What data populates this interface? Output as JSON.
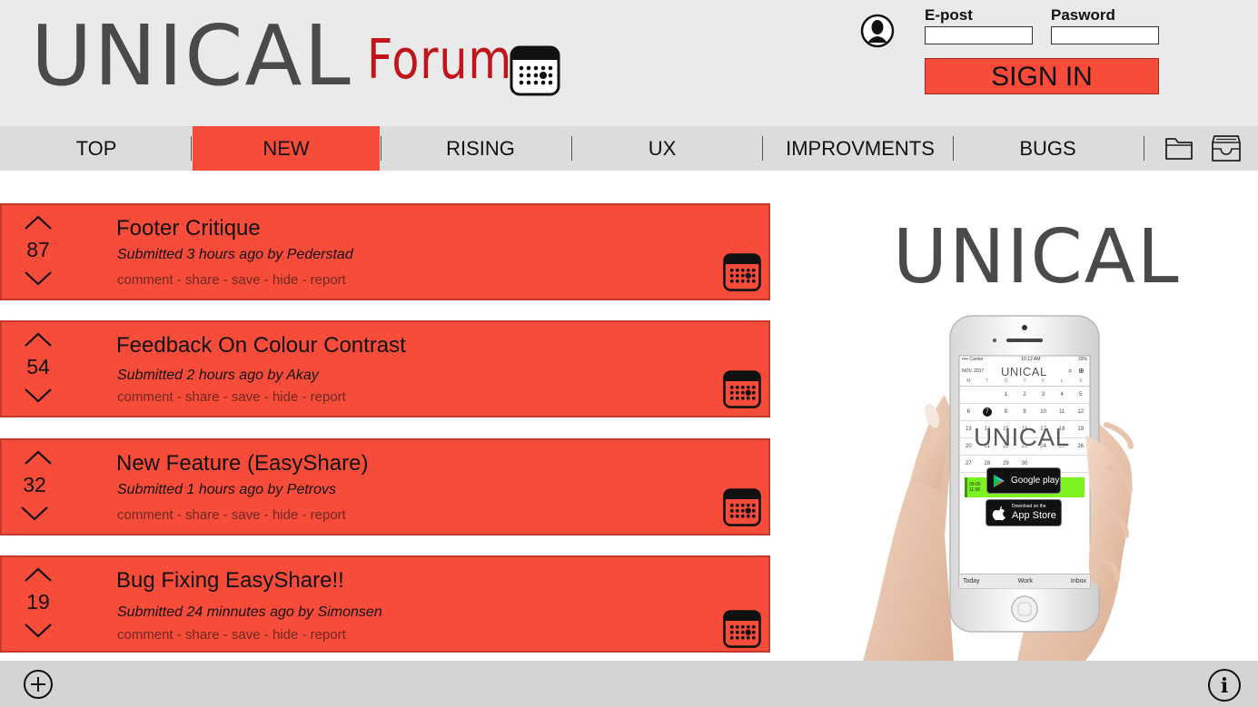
{
  "header": {
    "logo_text": "UNICAL",
    "forum_text": "Forum",
    "email_label": "E-post",
    "password_label": "Pasword",
    "email_value": "",
    "password_value": "",
    "signin_label": "SIGN IN"
  },
  "nav": {
    "tabs": [
      {
        "label": "TOP",
        "active": false
      },
      {
        "label": "NEW",
        "active": true
      },
      {
        "label": "RISING",
        "active": false
      },
      {
        "label": "UX",
        "active": false
      },
      {
        "label": "IMPROVMENTS",
        "active": false
      },
      {
        "label": "BUGS",
        "active": false
      }
    ],
    "icons": [
      "folder-icon",
      "inbox-icon"
    ]
  },
  "posts": [
    {
      "votes": "87",
      "title": "Footer Critique",
      "meta": "Submitted 3 hours ago by Pederstad"
    },
    {
      "votes": "54",
      "title": "Feedback On Colour Contrast",
      "meta": "Submitted 2 hours ago by Akay"
    },
    {
      "votes": "32",
      "title": "New Feature (EasyShare)",
      "meta": "Submitted 1 hours ago by Petrovs"
    },
    {
      "votes": "19",
      "title": "Bug Fixing EasyShare!!",
      "meta": "Submitted 24 minnutes ago by Simonsen"
    }
  ],
  "post_actions": {
    "comment": "comment",
    "share": "share",
    "save": "save",
    "hide": "hide",
    "report": "report",
    "separator": " - "
  },
  "promo": {
    "logo_text": "UNICAL",
    "phone": {
      "status_carrier": "•••• Carrier",
      "status_time": "10:12 AM",
      "status_battery": "33%",
      "back_label": "NOV. 2017",
      "title": "UNICAL",
      "weekdays": [
        "M",
        "T",
        "O",
        "T",
        "F",
        "L",
        "S"
      ],
      "calendar_rows": [
        [
          "",
          "",
          "1",
          "2",
          "3",
          "4",
          "5"
        ],
        [
          "6",
          "7",
          "8",
          "9",
          "10",
          "11",
          "12"
        ],
        [
          "13",
          "14",
          "15",
          "16",
          "17",
          "18",
          "19"
        ],
        [
          "20",
          "21",
          "22",
          "23",
          "24",
          "25",
          "26"
        ],
        [
          "27",
          "28",
          "29",
          "30",
          "",
          "",
          ""
        ]
      ],
      "selected_day": "7",
      "overlay_title": "UNICAL",
      "event_time_start": "09:00",
      "event_time_end": "11:00",
      "google_play_label": "Google play",
      "app_store_top": "Download on the",
      "app_store_label": "App Store",
      "tab_today": "Today",
      "tab_work": "Work",
      "tab_inbox": "Inbox"
    }
  },
  "footer": {
    "icons": [
      "add-icon",
      "info-icon"
    ]
  },
  "colors": {
    "accent": "#f84c3a",
    "logo_gray": "#4a4a4a",
    "forum_red": "#c1151b",
    "header_bg": "#eaeaea",
    "nav_bg": "#dcdcdc",
    "footer_bg": "#d4d4d4"
  }
}
